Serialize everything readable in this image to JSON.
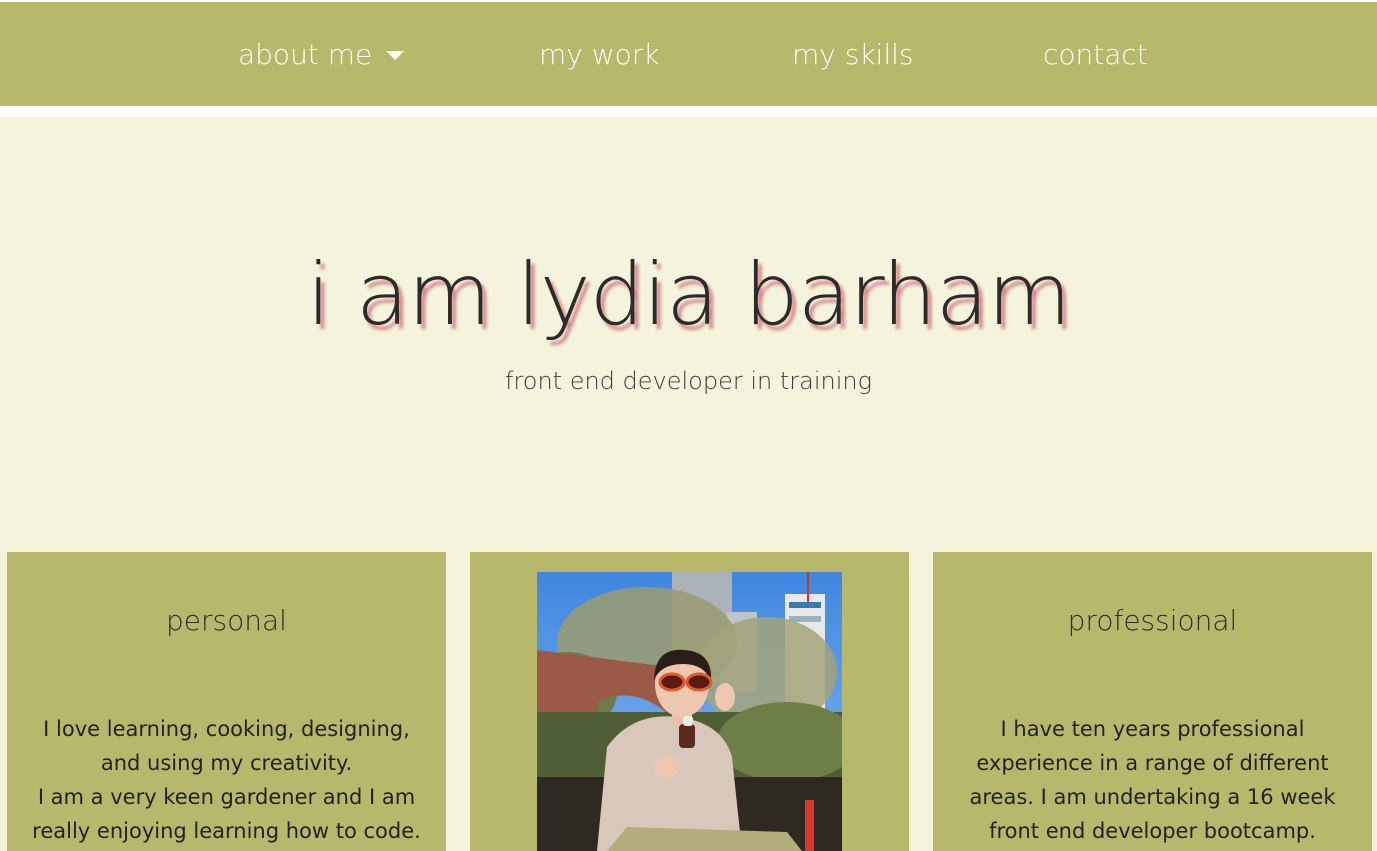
{
  "nav": {
    "items": [
      {
        "label": "about me",
        "dropdown": true
      },
      {
        "label": "my work"
      },
      {
        "label": "my skills"
      },
      {
        "label": "contact"
      }
    ]
  },
  "hero": {
    "title": "i am lydia barham",
    "subtitle": "front end developer in training"
  },
  "cards": {
    "personal": {
      "heading": "personal",
      "lines": [
        "I love learning, cooking, designing, and using my creativity.",
        "I am a very keen gardener and I am really enjoying learning how to code."
      ]
    },
    "photo": {
      "icon": "portrait-photo"
    },
    "professional": {
      "heading": "professional",
      "lines": [
        "I have ten years professional experience in a range of different areas. I am undertaking a 16 week front end developer bootcamp."
      ]
    }
  },
  "colors": {
    "nav_bg": "#b8b86c",
    "hero_bg": "#f4f4dc",
    "card_bg": "#b8b86c",
    "title_shadow": "#c85a69"
  }
}
